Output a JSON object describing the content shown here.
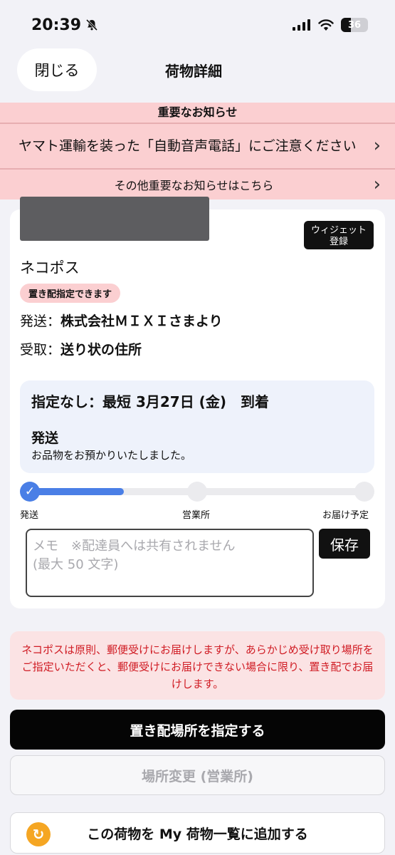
{
  "status_bar": {
    "time": "20:39",
    "battery_percent": "36",
    "battery_level": 0.36
  },
  "nav": {
    "close_label": "閉じる",
    "title": "荷物詳細"
  },
  "notices": {
    "header": "重要なお知らせ",
    "item1": "ヤマト運輸を装った「自動音声電話」にご注意ください",
    "item2": "その他重要なお知らせはこちら"
  },
  "package": {
    "widget_button": "ウィジェット\n登録",
    "service_name": "ネコポス",
    "badge": "置き配指定できます",
    "sender_label": "発送：",
    "sender_value": "株式会社ＭＩＸＩさまより",
    "recipient_label": "受取：",
    "recipient_value": "送り状の住所",
    "eta": "指定なし：最短 3月27日 (金)　到着",
    "stage_title": "発送",
    "stage_desc": "お品物をお預かりいたしました。",
    "progress": 0.28,
    "steps": [
      "発送",
      "営業所",
      "お届け予定"
    ],
    "memo_placeholder": "メモ　※配達員へは共有されません\n(最大 50 文字)",
    "save_label": "保存"
  },
  "note": "ネコポスは原則、郵便受けにお届けしますが、あらかじめ受け取り場所をご指定いただくと、郵便受けにお届けできない場合に限り、置き配でお届けします。",
  "buttons": {
    "specify_drop": "置き配場所を指定する",
    "change_location": "場所変更 (営業所)",
    "add_to_my_list": "この荷物を My 荷物一覧に追加する"
  },
  "colors": {
    "accent": "#4a7fe6",
    "notice_bg": "#fbcfd1",
    "warning_text": "#d01c24",
    "add_icon": "#f5a623"
  }
}
